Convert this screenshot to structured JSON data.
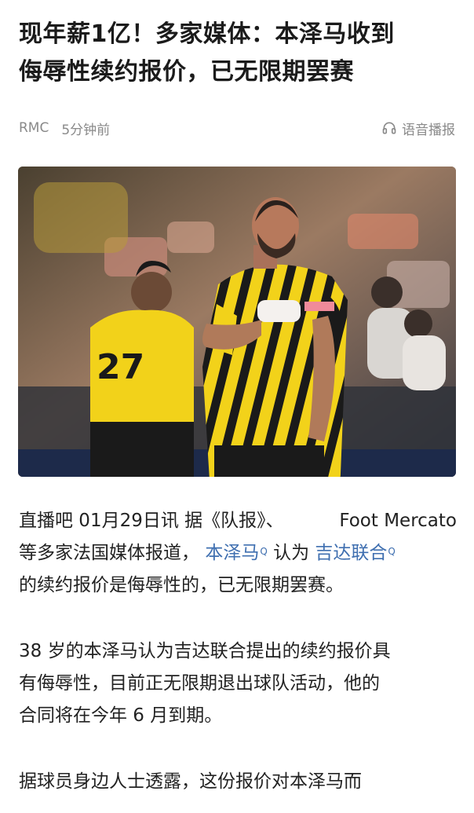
{
  "article": {
    "title_line1": "现年薪1亿！多家媒体：本泽马收到",
    "title_line2": "侮辱性续约报价，已无限期罢赛",
    "source": "RMC",
    "time": "5分钟前",
    "listen_label": "语音播报",
    "image_alt": "本泽马身穿吉达联合黄黑条纹球衣，手腕缠有绷带；背景为27号球员和看台观众",
    "jersey_number": "27",
    "paragraph1": {
      "line1_a": "直播吧 01月29日讯  据《队报》、",
      "line1_b": "Foot  Mercato",
      "line2_a": "等多家法国媒体报道，",
      "link1": "本泽马",
      "line2_b": "认为",
      "link2": "吉达联合",
      "line3": "的续约报价是侮辱性的，已无限期罢赛。"
    },
    "paragraph2": {
      "line1": "38 岁的本泽马认为吉达联合提出的续约报价具",
      "line2": "有侮辱性，目前正无限期退出球队活动，他的",
      "line3": "合同将在今年 6 月到期。"
    },
    "paragraph3": {
      "line1": "据球员身边人士透露，这份报价对本泽马而"
    },
    "link_marker": "Q"
  },
  "colors": {
    "text": "#222222",
    "link": "#3f6fb0",
    "meta": "#8a8a8a",
    "jersey_yellow": "#f2d21a",
    "jersey_black": "#1a1a1a"
  },
  "icons": {
    "listen": "headphones-icon",
    "link_search": "search-marker-icon"
  }
}
